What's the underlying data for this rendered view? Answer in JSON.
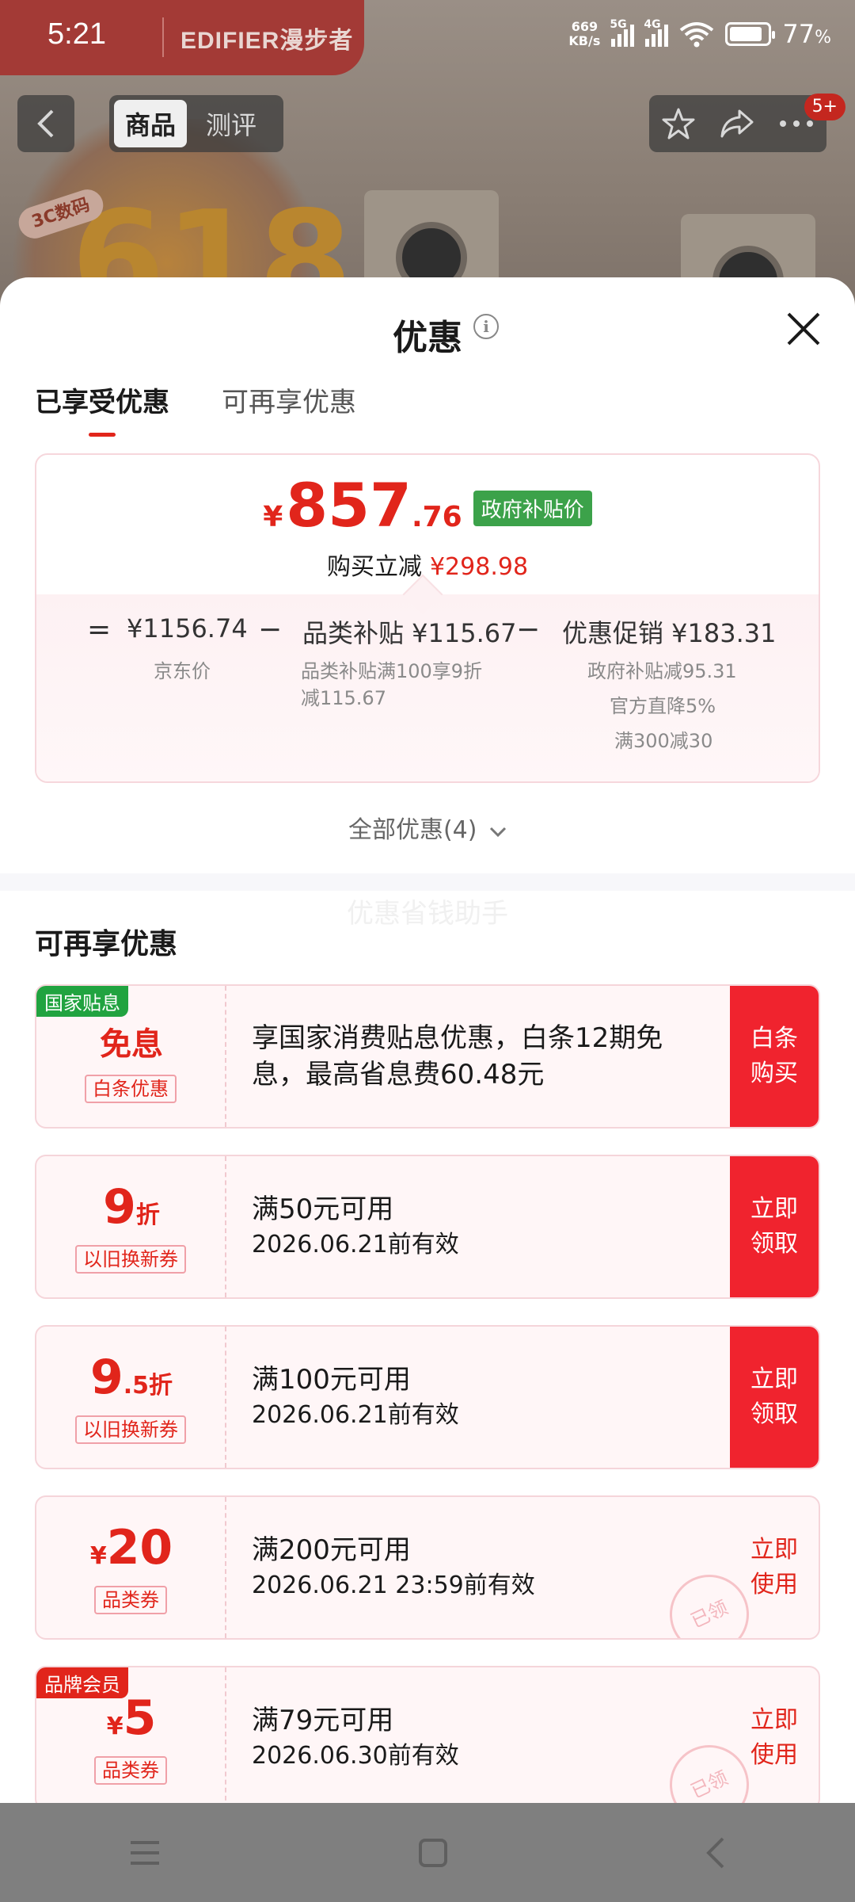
{
  "status_bar": {
    "time": "5:21",
    "net_speed_value": "669",
    "net_speed_unit": "KB/s",
    "signal1_label": "5G",
    "signal2_label": "4G",
    "battery_pct": "77",
    "battery_unit": "%"
  },
  "background_page": {
    "brand_text": "EDIFIER漫步者",
    "tab_product": "商品",
    "tab_review": "测评",
    "badge": "5+",
    "poster_tag": "3C数码",
    "poster_text": "618"
  },
  "sheet": {
    "title": "优惠",
    "info_icon": "i",
    "tabs": [
      "已享受优惠",
      "可再享优惠"
    ],
    "price": {
      "yen": "¥",
      "integer": "857",
      "decimal": ".76",
      "tag": "政府补贴价",
      "discount_label": "购买立减",
      "discount_amount": "¥298.98"
    },
    "formula": {
      "eq": "=",
      "minus": "−",
      "jd_price": "¥1156.74",
      "jd_price_label": "京东价",
      "category_subsidy": "品类补贴 ¥115.67",
      "category_subsidy_desc1": "品类补贴满100享9折",
      "category_subsidy_desc2": "减115.67",
      "promo": "优惠促销 ¥183.31",
      "promo_desc": [
        "政府补贴减95.31",
        "官方直降5%",
        "满300减30"
      ]
    },
    "all_promos": "全部优惠(4)",
    "watermark": "优惠省钱助手",
    "more_title": "可再享优惠",
    "coupons": [
      {
        "corner": "国家贴息",
        "big": "免息",
        "tag": "白条优惠",
        "line1": "享国家消费贴息优惠，白条12期免",
        "line2": "息，最高省息费60.48元",
        "action": "白条购买"
      },
      {
        "big_num": "9",
        "big_suffix": "折",
        "tag": "以旧换新券",
        "line1": "满50元可用",
        "line2": "2026.06.21前有效",
        "action": "立即领取"
      },
      {
        "big_num": "9",
        "big_suffix": ".5折",
        "tag": "以旧换新券",
        "line1": "满100元可用",
        "line2": "2026.06.21前有效",
        "action": "立即领取"
      },
      {
        "big_prefix": "¥",
        "big_num": "20",
        "tag": "品类券",
        "line1": "满200元可用",
        "line2": "2026.06.21 23:59前有效",
        "action": "立即使用",
        "stamp": "已领"
      },
      {
        "corner": "品牌会员",
        "big_prefix": "¥",
        "big_num": "5",
        "tag": "品类券",
        "line1": "满79元可用",
        "line2": "2026.06.30前有效",
        "action": "立即使用",
        "stamp": "已领"
      }
    ]
  },
  "colors": {
    "accent_red": "#e1251b",
    "gov_green": "#3ca24a",
    "corner_green": "#21a340"
  }
}
